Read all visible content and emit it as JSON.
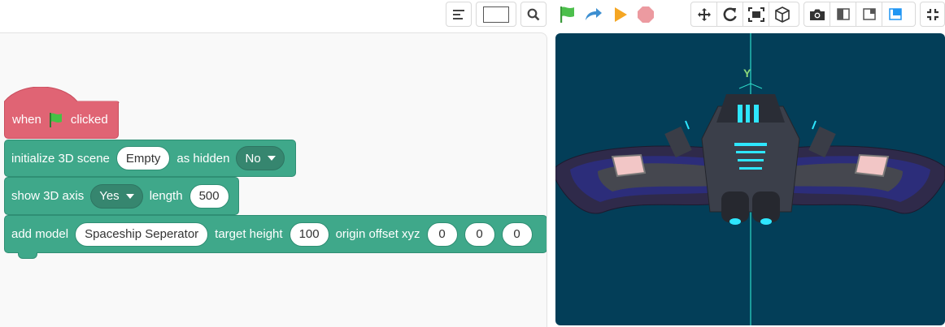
{
  "toolbar": {
    "left_icons": [
      "align-left-icon",
      "search-icon"
    ],
    "run_controls": [
      "green-flag-icon",
      "step-arrow-icon",
      "play-icon",
      "stop-icon"
    ],
    "camera_tools": [
      "move-icon",
      "rotate-icon",
      "fit-view-icon",
      "cube-icon"
    ],
    "view_tools": [
      "camera-icon",
      "layout-split-left-icon",
      "layout-small-stage-icon",
      "layout-large-stage-icon"
    ],
    "fullscreen_icon": "fullscreen-icon"
  },
  "blocks": {
    "hat": {
      "before_flag": "when",
      "after_flag": "clicked"
    },
    "init_scene": {
      "label": "initialize 3D scene",
      "scene_value": "Empty",
      "hidden_label": "as hidden",
      "hidden_value": "No"
    },
    "show_axis": {
      "label": "show 3D axis",
      "axis_value": "Yes",
      "length_label": "length",
      "length_value": "500"
    },
    "add_model": {
      "label": "add model",
      "model_value": "Spaceship Seperator",
      "height_label": "target height",
      "height_value": "100",
      "offset_label": "origin offset xyz",
      "x_value": "0",
      "y_value": "0",
      "z_value": "0"
    }
  },
  "stage": {
    "axis_label": "Y"
  },
  "colors": {
    "hat": "#e06474",
    "teal": "#3fa88a",
    "stage_bg": "#033e58",
    "axis": "#2ed9c8"
  }
}
